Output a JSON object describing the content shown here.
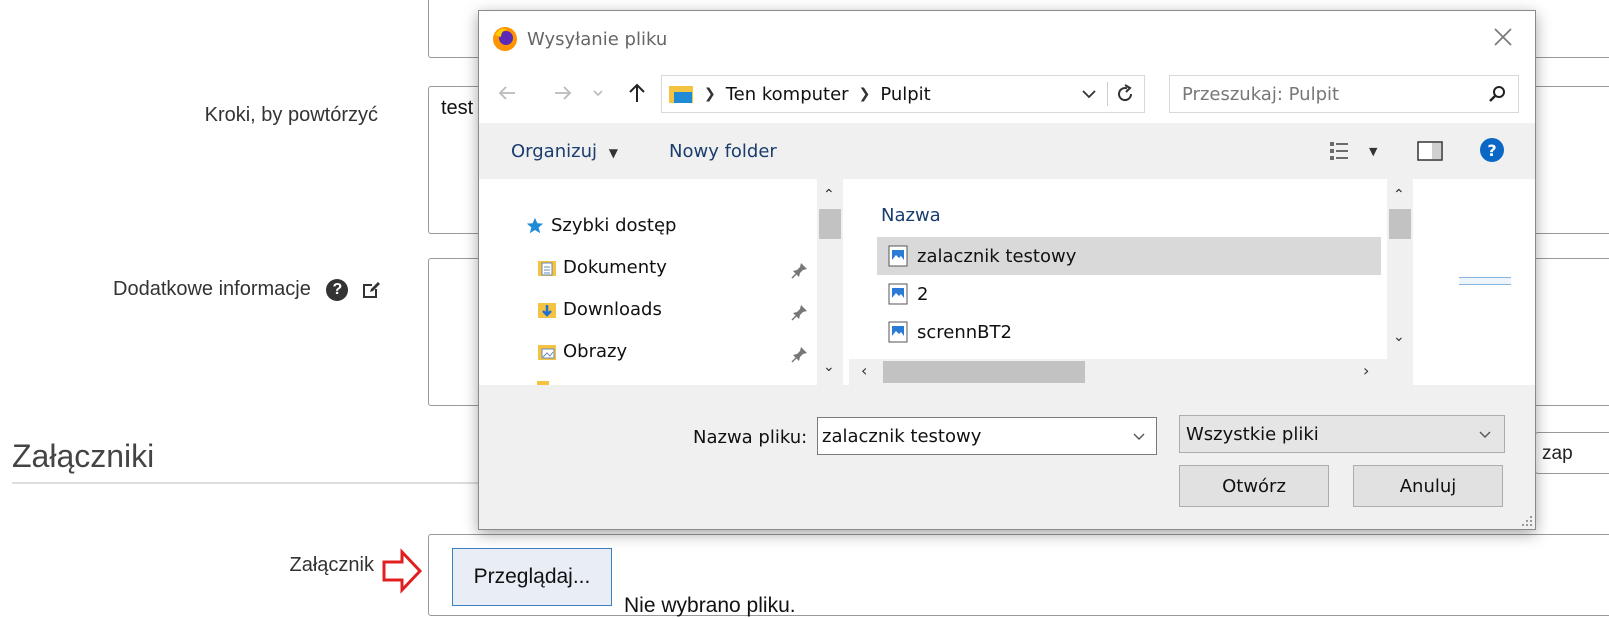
{
  "form": {
    "steps_label": "Kroki, by powtórzyć",
    "steps_value": "test",
    "additional_info_label": "Dodatkowe informacje",
    "help_glyph": "?",
    "attachments_heading": "Załączniki",
    "attachment_label": "Załącznik",
    "browse_button": "Przeglądaj...",
    "no_file_text": "Nie wybrano pliku.",
    "partial_text_right": "zap"
  },
  "dialog": {
    "title": "Wysyłanie pliku",
    "breadcrumb": [
      "Ten komputer",
      "Pulpit"
    ],
    "search_placeholder": "Przeszukaj: Pulpit",
    "organize_label": "Organizuj",
    "new_folder_label": "Nowy folder",
    "nav_items": [
      {
        "label": "Szybki dostęp",
        "icon": "star-icon"
      },
      {
        "label": "Dokumenty",
        "icon": "documents-folder-icon"
      },
      {
        "label": "Downloads",
        "icon": "downloads-folder-icon"
      },
      {
        "label": "Obrazy",
        "icon": "pictures-folder-icon"
      }
    ],
    "column_name": "Nazwa",
    "files": [
      "zalacznik testowy",
      "2",
      "scrennBT2"
    ],
    "selected_file": "zalacznik testowy",
    "filename_label": "Nazwa pliku:",
    "filename_value": "zalacznik testowy",
    "filetype_value": "Wszystkie pliki",
    "open_button": "Otwórz",
    "cancel_button": "Anuluj"
  },
  "colors": {
    "accent": "#0063b1",
    "arrow_red": "#e02020",
    "help_blue": "#0a68c4"
  }
}
